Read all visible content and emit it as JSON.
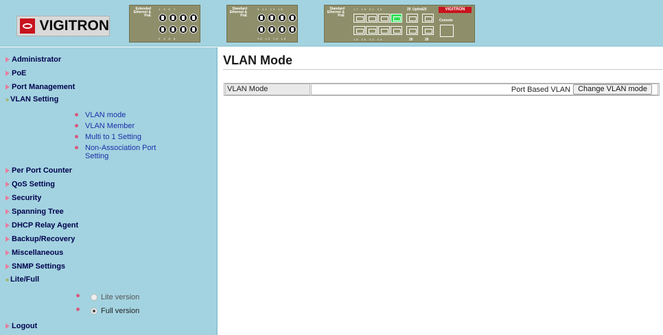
{
  "header": {
    "brand": "VIGITRON",
    "panel1": {
      "label": "Extended Ethernet & PoE",
      "top_ports": "1 3 5 7",
      "bottom_ports": "2 4 6 8"
    },
    "panel2": {
      "label": "Standard Ethernet & PoE",
      "top_ports": "9 11 13 15",
      "bottom_ports": "10 12 14 16"
    },
    "panel3": {
      "label": "Standard Ethernet & PoE",
      "top_ports": "17 19 21 23",
      "bottom_ports": "18 20 22 24",
      "uplink": "Uplink",
      "p25": "25",
      "p26": "26",
      "console": "Console",
      "active_port": 23
    }
  },
  "sidebar": {
    "items": [
      {
        "label": "Administrator"
      },
      {
        "label": "PoE"
      },
      {
        "label": "Port Management"
      },
      {
        "label": "VLAN Setting",
        "expanded": true
      },
      {
        "label": "Per Port Counter"
      },
      {
        "label": "QoS Setting"
      },
      {
        "label": "Security"
      },
      {
        "label": "Spanning Tree"
      },
      {
        "label": "DHCP Relay Agent"
      },
      {
        "label": "Backup/Recovery"
      },
      {
        "label": "Miscellaneous"
      },
      {
        "label": "SNMP Settings"
      },
      {
        "label": "Lite/Full",
        "expanded": true
      },
      {
        "label": "Logout"
      }
    ],
    "vlan_sub": [
      {
        "label": "VLAN mode"
      },
      {
        "label": "VLAN Member"
      },
      {
        "label": "Multi to 1 Setting"
      },
      {
        "label": "Non-Association Port Setting"
      }
    ],
    "lite_full": [
      {
        "label": "Lite version",
        "checked": false
      },
      {
        "label": "Full version",
        "checked": true
      }
    ]
  },
  "main": {
    "title": "VLAN Mode",
    "row_label": "VLAN Mode",
    "row_value": "Port Based VLAN",
    "button_label": "Change VLAN mode"
  }
}
